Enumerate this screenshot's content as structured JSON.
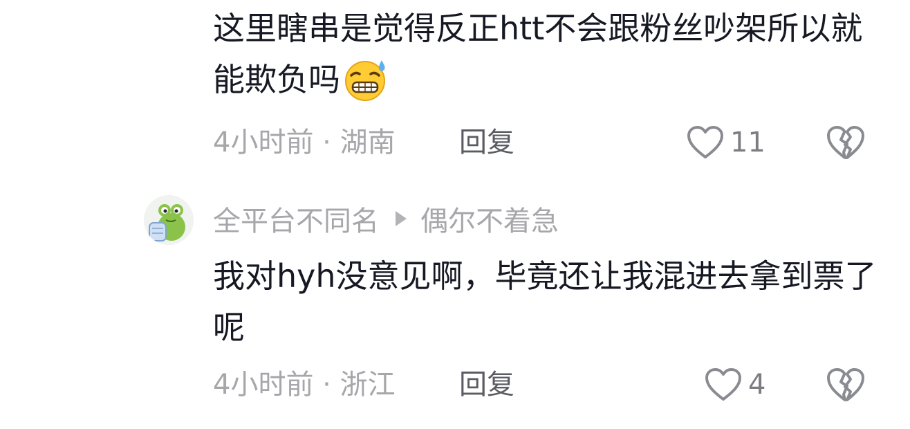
{
  "comments": [
    {
      "text": "这里瞎串是觉得反正htt不会跟粉丝吵架所以就能欺负吗",
      "emoji": "grimacing-sweat-emoji",
      "time_location": "4小时前 · 湖南",
      "reply_label": "回复",
      "like_count": "11"
    },
    {
      "author": "全平台不同名",
      "reply_to": "偶尔不着急",
      "text": "我对hyh没意见啊，毕竟还让我混进去拿到票了呢",
      "time_location": "4小时前 · 浙江",
      "reply_label": "回复",
      "like_count": "4"
    }
  ],
  "icons": {
    "like": "heart-outline-icon",
    "dislike": "broken-heart-icon",
    "reply_arrow": "triangle-right-icon"
  },
  "colors": {
    "text_primary": "#161823",
    "text_secondary": "#a7a7ab",
    "reply_label": "#5b5c63",
    "icon_gray": "#8a8b91",
    "avatar_green": "#8bc34a"
  }
}
